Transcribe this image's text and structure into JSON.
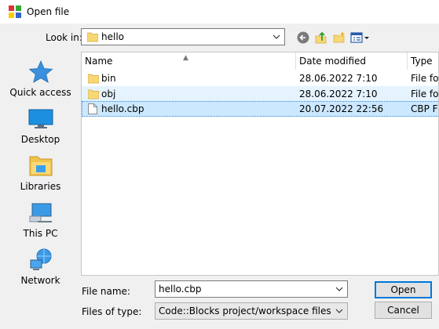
{
  "window": {
    "title": "Open file"
  },
  "lookin": {
    "label": "Look in:",
    "value": "hello",
    "toolbar_icons": [
      "back-icon",
      "up-folder-icon",
      "new-folder-icon",
      "view-menu-icon"
    ]
  },
  "places": [
    {
      "label": "Quick access",
      "icon": "star-icon"
    },
    {
      "label": "Desktop",
      "icon": "desktop-icon"
    },
    {
      "label": "Libraries",
      "icon": "libraries-icon"
    },
    {
      "label": "This PC",
      "icon": "computer-icon"
    },
    {
      "label": "Network",
      "icon": "network-icon"
    }
  ],
  "filelist": {
    "columns": [
      "Name",
      "Date modified",
      "Type"
    ],
    "rows": [
      {
        "name": "bin",
        "date": "28.06.2022 7:10",
        "type": "File fo",
        "icon": "folder-icon"
      },
      {
        "name": "obj",
        "date": "28.06.2022 7:10",
        "type": "File fo",
        "icon": "folder-icon"
      },
      {
        "name": "hello.cbp",
        "date": "20.07.2022 22:56",
        "type": "CBP F",
        "icon": "file-icon"
      }
    ]
  },
  "filename": {
    "label": "File name:",
    "value": "hello.cbp"
  },
  "filetype": {
    "label": "Files of type:",
    "value": "Code::Blocks project/workspace files"
  },
  "buttons": {
    "open": "Open",
    "cancel": "Cancel"
  },
  "colors": {
    "accent": "#0078d7",
    "selection": "#cce8ff",
    "hover": "#e5f3ff",
    "folder": "#f8d775"
  }
}
